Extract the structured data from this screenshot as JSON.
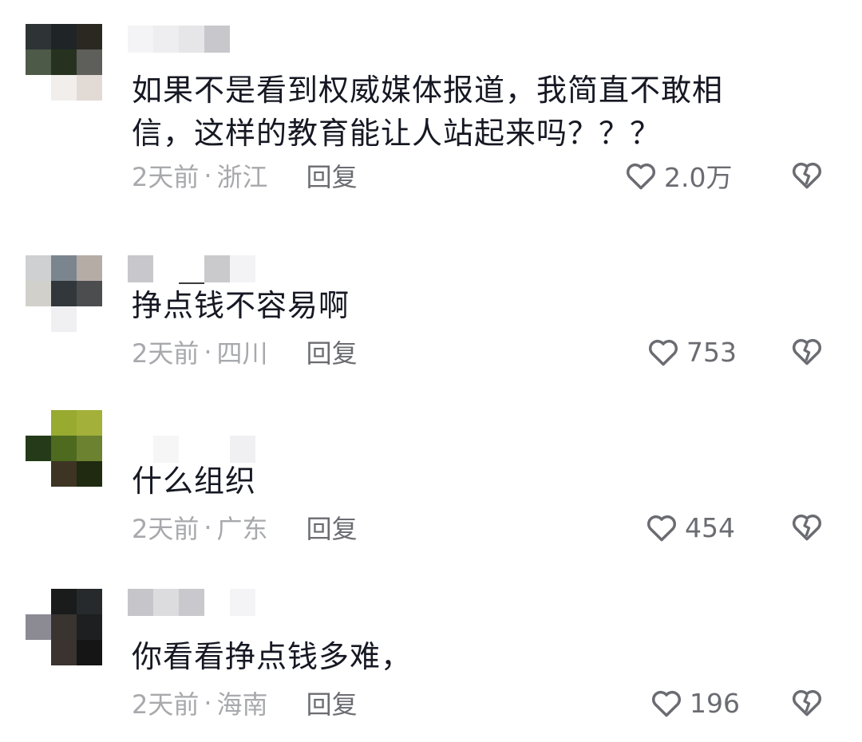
{
  "comments": [
    {
      "text_line1": "如果不是看到权威媒体报道，我简直不敢相",
      "text_line2": "信，这样的教育能让人站起来吗？？？",
      "time": "2天前",
      "separator": "·",
      "location": "浙江",
      "reply_label": "回复",
      "like_count": "2.0万"
    },
    {
      "text_line1": "挣点钱不容易啊",
      "text_line2": "",
      "time": "2天前",
      "separator": "·",
      "location": "四川",
      "reply_label": "回复",
      "like_count": "753"
    },
    {
      "text_line1": "什么组织",
      "text_line2": "",
      "time": "2天前",
      "separator": "·",
      "location": "广东",
      "reply_label": "回复",
      "like_count": "454"
    },
    {
      "text_line1": "你看看挣点钱多难，",
      "text_line2": "",
      "time": "2天前",
      "separator": "·",
      "location": "海南",
      "reply_label": "回复",
      "like_count": "196"
    }
  ],
  "icons": {
    "like": "heart-outline-icon",
    "dislike": "broken-heart-icon"
  },
  "colors": {
    "text": "#161823",
    "meta": "#a8a9ad",
    "action": "#6b6c72"
  }
}
